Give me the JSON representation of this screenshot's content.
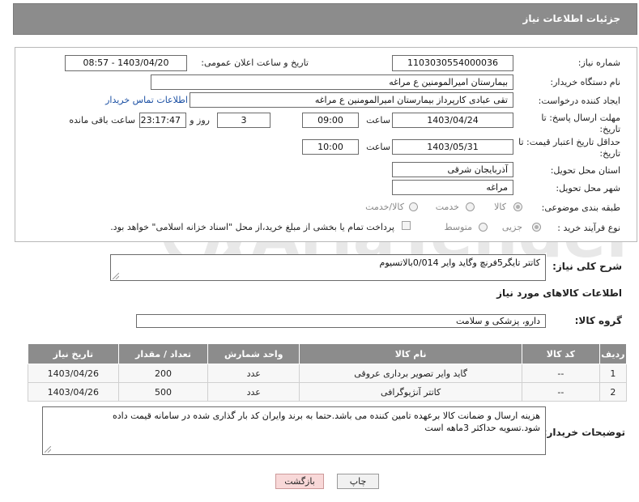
{
  "header": {
    "title": "جزئیات اطلاعات نیاز"
  },
  "form": {
    "need_number_label": "شماره نیاز:",
    "need_number": "1103030554000036",
    "announce_label": "تاریخ و ساعت اعلان عمومی:",
    "announce_value": "1403/04/20 - 08:57",
    "buyer_label": "نام دستگاه خریدار:",
    "buyer_value": "بیمارستان امیرالمومنین ع  مراغه",
    "creator_label": "ایجاد کننده درخواست:",
    "creator_value": "تقی عبادی کارپرداز بیمارستان امیرالمومنین ع  مراغه",
    "contact_link": "اطلاعات تماس خریدار",
    "deadline_label_1": "مهلت ارسال پاسخ: تا",
    "deadline_label_2": "تاریخ:",
    "deadline_date": "1403/04/24",
    "time_label": "ساعت",
    "deadline_time": "09:00",
    "days_value": "3",
    "days_label": "روز و",
    "remaining_value": "23:17:47",
    "remaining_label": "ساعت باقی مانده",
    "validity_label_1": "حداقل تاریخ اعتبار قیمت: تا",
    "validity_label_2": "تاریخ:",
    "validity_date": "1403/05/31",
    "validity_time": "10:00",
    "province_label": "استان محل تحویل:",
    "province_value": "آذربایجان شرقی",
    "city_label": "شهر محل تحویل:",
    "city_value": "مراغه",
    "category_label": "طبقه بندی موضوعی:",
    "category_options": [
      "کالا",
      "خدمت",
      "کالا/خدمت"
    ],
    "process_label": "نوع فرآیند خرید :",
    "process_options": [
      "جزیی",
      "متوسط"
    ],
    "treasury_note": "پرداخت تمام یا بخشی از مبلغ خرید،از محل \"اسناد خزانه اسلامی\" خواهد بود."
  },
  "summary": {
    "label": "شرح کلی نیاز:",
    "value": "کاتتر تایگر5فرنچ وگاید وایر 0/014بالاتسیوم"
  },
  "goods_section": {
    "title": "اطلاعات کالاهای مورد نیاز",
    "group_label": "گروه کالا:",
    "group_value": "دارو، پزشکی و سلامت"
  },
  "table": {
    "headers": [
      "ردیف",
      "کد کالا",
      "نام کالا",
      "واحد شمارش",
      "تعداد / مقدار",
      "تاریخ نیاز"
    ],
    "rows": [
      {
        "row": "1",
        "code": "--",
        "name": "گاید وایر تصویر برداری عروقی",
        "unit": "عدد",
        "qty": "200",
        "date": "1403/04/26"
      },
      {
        "row": "2",
        "code": "--",
        "name": "کاتتر آنژیوگرافی",
        "unit": "عدد",
        "qty": "500",
        "date": "1403/04/26"
      }
    ]
  },
  "notes": {
    "label": "توضیحات خریدار:",
    "line1": "هزینه ارسال و ضمانت کالا برعهده تامین کننده می باشد.حتما به برند وایران کد بار گذاری شده در سامانه قیمت داده",
    "line2": "شود.تسویه حداکثر 3ماهه است"
  },
  "buttons": {
    "print": "چاپ",
    "back": "بازگشت"
  },
  "watermark": "AriaTender.neT",
  "colors": {
    "header": "#8c8c8c",
    "link": "#1a4fa3",
    "back_button": "#f8d8d8"
  }
}
